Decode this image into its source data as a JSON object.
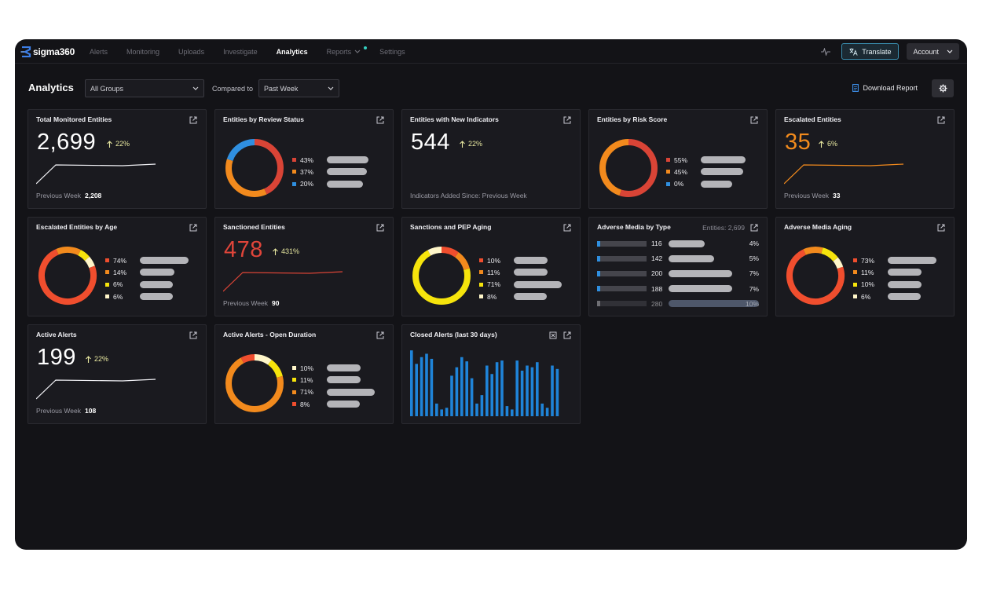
{
  "app": {
    "logo_text": "sigma360",
    "nav": [
      {
        "label": "Alerts",
        "active": false
      },
      {
        "label": "Monitoring",
        "active": false
      },
      {
        "label": "Uploads",
        "active": false
      },
      {
        "label": "Investigate",
        "active": false
      },
      {
        "label": "Analytics",
        "active": true
      },
      {
        "label": "Reports",
        "active": false
      },
      {
        "label": "Settings",
        "active": false
      }
    ],
    "translate_label": "Translate",
    "account_label": "Account"
  },
  "toolbar": {
    "title": "Analytics",
    "group_select": "All Groups",
    "compared_label": "Compared to",
    "compare_select": "Past Week",
    "download_label": "Download Report"
  },
  "colors": {
    "red": "#d94436",
    "orange": "#f28a1d",
    "yellow": "#f6e40c",
    "pale": "#fff6c9",
    "blue": "#2f8fe0",
    "bar_grey": "#b4b4b8"
  },
  "cards": {
    "total_monitored": {
      "title": "Total Monitored Entities",
      "value": "2,699",
      "delta": "22%",
      "foot_label": "Previous Week",
      "foot_value": "2,208"
    },
    "review_status": {
      "title": "Entities by Review Status",
      "legend": [
        {
          "pct": "43%",
          "value": 43,
          "color": "#d94436"
        },
        {
          "pct": "37%",
          "value": 37,
          "color": "#f28a1d"
        },
        {
          "pct": "20%",
          "value": 20,
          "color": "#2f8fe0"
        }
      ]
    },
    "new_indicators": {
      "title": "Entities with New Indicators",
      "value": "544",
      "delta": "22%",
      "foot_label": "Indicators Added Since: Previous Week"
    },
    "risk_score": {
      "title": "Entities by Risk Score",
      "legend": [
        {
          "pct": "55%",
          "value": 55,
          "color": "#d94436"
        },
        {
          "pct": "45%",
          "value": 45,
          "color": "#f28a1d"
        },
        {
          "pct": "0%",
          "value": 0,
          "color": "#2f8fe0"
        }
      ]
    },
    "escalated": {
      "title": "Escalated Entities",
      "value": "35",
      "delta": "6%",
      "foot_label": "Previous Week",
      "foot_value": "33"
    },
    "escalated_age": {
      "title": "Escalated Entities by Age",
      "legend": [
        {
          "pct": "74%",
          "value": 74,
          "color": "#f04e2e"
        },
        {
          "pct": "14%",
          "value": 14,
          "color": "#f28a1d"
        },
        {
          "pct": "6%",
          "value": 6,
          "color": "#f6e40c"
        },
        {
          "pct": "6%",
          "value": 6,
          "color": "#fff6c9"
        }
      ]
    },
    "sanctioned": {
      "title": "Sanctioned Entities",
      "value": "478",
      "delta": "431%",
      "foot_label": "Previous Week",
      "foot_value": "90"
    },
    "sanctions_pep": {
      "title": "Sanctions and PEP Aging",
      "legend": [
        {
          "pct": "10%",
          "value": 10,
          "color": "#f04e2e"
        },
        {
          "pct": "11%",
          "value": 11,
          "color": "#f28a1d"
        },
        {
          "pct": "71%",
          "value": 71,
          "color": "#f6e40c"
        },
        {
          "pct": "8%",
          "value": 8,
          "color": "#fff6c9"
        }
      ]
    },
    "adverse_type": {
      "title": "Adverse Media by Type",
      "subtitle": "Entities: 2,699",
      "rows": [
        {
          "count": "116",
          "pct": "4%",
          "value": 4
        },
        {
          "count": "142",
          "pct": "5%",
          "value": 5
        },
        {
          "count": "200",
          "pct": "7%",
          "value": 7
        },
        {
          "count": "188",
          "pct": "7%",
          "value": 7
        },
        {
          "count": "280",
          "pct": "10%",
          "value": 10
        }
      ]
    },
    "adverse_aging": {
      "title": "Adverse Media Aging",
      "legend": [
        {
          "pct": "73%",
          "value": 73,
          "color": "#f04e2e"
        },
        {
          "pct": "11%",
          "value": 11,
          "color": "#f28a1d"
        },
        {
          "pct": "10%",
          "value": 10,
          "color": "#f6e40c"
        },
        {
          "pct": "6%",
          "value": 6,
          "color": "#fff6c9"
        }
      ]
    },
    "active_alerts": {
      "title": "Active Alerts",
      "value": "199",
      "delta": "22%",
      "foot_label": "Previous Week",
      "foot_value": "108"
    },
    "open_duration": {
      "title": "Active Alerts - Open Duration",
      "legend": [
        {
          "pct": "10%",
          "value": 10,
          "color": "#fff6c9"
        },
        {
          "pct": "11%",
          "value": 11,
          "color": "#f6e40c"
        },
        {
          "pct": "71%",
          "value": 71,
          "color": "#f28a1d"
        },
        {
          "pct": "8%",
          "value": 8,
          "color": "#f04e2e"
        }
      ]
    },
    "closed_alerts": {
      "title": "Closed Alerts (last 30 days)"
    }
  },
  "chart_data": {
    "type": "bar",
    "title": "Closed Alerts (last 30 days)",
    "values": [
      78,
      62,
      70,
      74,
      68,
      15,
      8,
      10,
      48,
      58,
      70,
      65,
      45,
      15,
      25,
      60,
      50,
      64,
      66,
      12,
      8,
      66,
      54,
      60,
      58,
      64,
      15,
      10,
      60,
      56
    ],
    "ylim": [
      0,
      80
    ],
    "color": "#1f84d8"
  }
}
